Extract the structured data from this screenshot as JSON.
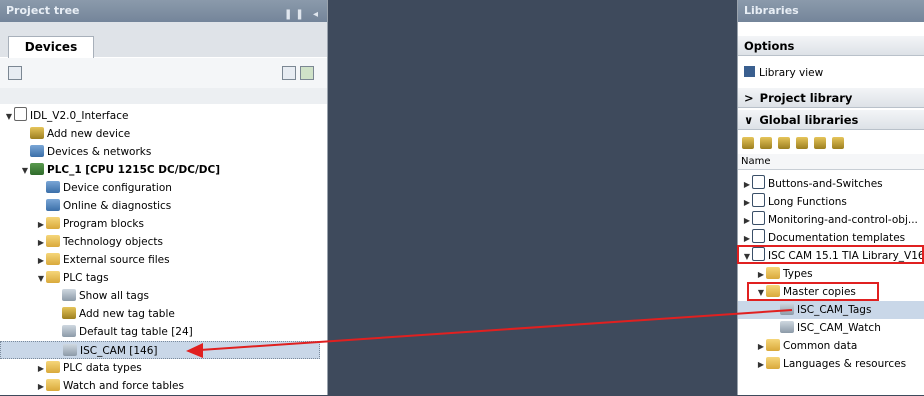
{
  "left_panel": {
    "title": "Project tree",
    "tab": "Devices",
    "tree": [
      {
        "label": "IDL_V2.0_Interface",
        "indent": 0,
        "expander": "▼",
        "icon": "project-icon"
      },
      {
        "label": "Add new device",
        "indent": 1,
        "expander": "",
        "icon": "add-device-icon"
      },
      {
        "label": "Devices & networks",
        "indent": 1,
        "expander": "",
        "icon": "network-icon"
      },
      {
        "label": "PLC_1 [CPU 1215C DC/DC/DC]",
        "indent": 1,
        "expander": "▼",
        "icon": "plc-icon",
        "bold": true
      },
      {
        "label": "Device configuration",
        "indent": 2,
        "expander": "",
        "icon": "device-config-icon"
      },
      {
        "label": "Online & diagnostics",
        "indent": 2,
        "expander": "",
        "icon": "diagnostics-icon"
      },
      {
        "label": "Program blocks",
        "indent": 2,
        "expander": "▶",
        "icon": "folder-icon"
      },
      {
        "label": "Technology objects",
        "indent": 2,
        "expander": "▶",
        "icon": "folder-icon"
      },
      {
        "label": "External source files",
        "indent": 2,
        "expander": "▶",
        "icon": "folder-icon"
      },
      {
        "label": "PLC tags",
        "indent": 2,
        "expander": "▼",
        "icon": "folder-icon"
      },
      {
        "label": "Show all tags",
        "indent": 3,
        "expander": "",
        "icon": "tags-icon"
      },
      {
        "label": "Add new tag table",
        "indent": 3,
        "expander": "",
        "icon": "add-table-icon"
      },
      {
        "label": "Default tag table [24]",
        "indent": 3,
        "expander": "",
        "icon": "tag-table-icon"
      },
      {
        "label": "ISC_CAM [146]",
        "indent": 3,
        "expander": "",
        "icon": "tag-table-icon",
        "selected": true
      },
      {
        "label": "PLC data types",
        "indent": 2,
        "expander": "▶",
        "icon": "folder-icon"
      },
      {
        "label": "Watch and force tables",
        "indent": 2,
        "expander": "▶",
        "icon": "folder-icon"
      }
    ]
  },
  "right_panel": {
    "title": "Libraries",
    "options": "Options",
    "library_view": "Library view",
    "project_library": "Project library",
    "global_libraries": "Global libraries",
    "name_header": "Name",
    "items": [
      {
        "label": "Buttons-and-Switches",
        "indent": 0,
        "expander": "▶"
      },
      {
        "label": "Long Functions",
        "indent": 0,
        "expander": "▶"
      },
      {
        "label": "Monitoring-and-control-obj...",
        "indent": 0,
        "expander": "▶"
      },
      {
        "label": "Documentation templates",
        "indent": 0,
        "expander": "▶"
      },
      {
        "label": "ISC CAM 15.1 TIA Library_V16",
        "indent": 0,
        "expander": "▼"
      },
      {
        "label": "Types",
        "indent": 1,
        "expander": "▶"
      },
      {
        "label": "Master copies",
        "indent": 1,
        "expander": "▼"
      },
      {
        "label": "ISC_CAM_Tags",
        "indent": 2,
        "expander": "",
        "selected": true
      },
      {
        "label": "ISC_CAM_Watch",
        "indent": 2,
        "expander": ""
      },
      {
        "label": "Common data",
        "indent": 1,
        "expander": "▶"
      },
      {
        "label": "Languages & resources",
        "indent": 1,
        "expander": "▶"
      }
    ]
  },
  "colors": {
    "panel_header": "#74859a",
    "workspace": "#3e4a5c",
    "selection": "#c9d7e8",
    "highlight": "#e02020"
  }
}
